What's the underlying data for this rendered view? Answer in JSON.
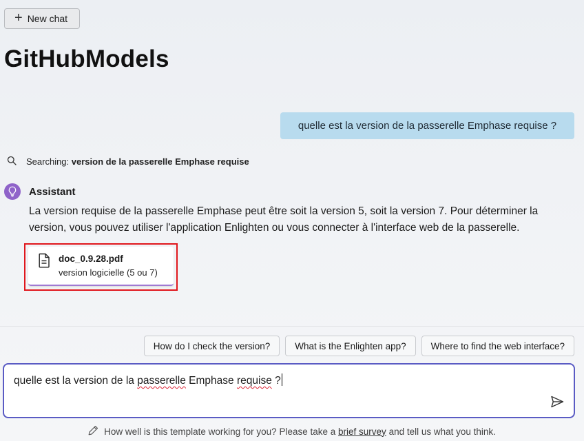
{
  "header": {
    "new_chat_label": "New chat",
    "title": "GitHubModels"
  },
  "conversation": {
    "user_message": "quelle est la version de la passerelle Emphase requise ?",
    "search": {
      "prefix": "Searching:",
      "query": "version de la passerelle Emphase requise"
    },
    "assistant": {
      "name": "Assistant",
      "text": "La version requise de la passerelle Emphase peut être soit la version 5, soit la version 7. Pour déterminer la version, vous pouvez utiliser l'application Enlighten ou vous connecter à l'interface web de la passerelle.",
      "citation": {
        "file_name": "doc_0.9.28.pdf",
        "excerpt": "version logicielle (5 ou 7)"
      }
    }
  },
  "suggestions": [
    "How do I check the version?",
    "What is the Enlighten app?",
    "Where to find the web interface?"
  ],
  "input": {
    "value_parts": {
      "p1": "quelle est la version de la ",
      "p2": "passerelle",
      "p3": " Emphase ",
      "p4": "requise",
      "p5": " ?"
    }
  },
  "footer": {
    "text_before": "How well is this template working for you? Please take a",
    "link": "brief survey",
    "text_after": "and tell us what you think."
  },
  "colors": {
    "user_bubble": "#b8dbee",
    "accent_purple": "#8f63c9",
    "input_border": "#5a5bc4",
    "highlight_red": "#e0161c"
  },
  "icons": {
    "new_chat": "plus-icon",
    "search": "search-icon",
    "assistant": "lightbulb-icon",
    "document": "document-icon",
    "send": "send-icon",
    "feedback": "pencil-icon"
  }
}
